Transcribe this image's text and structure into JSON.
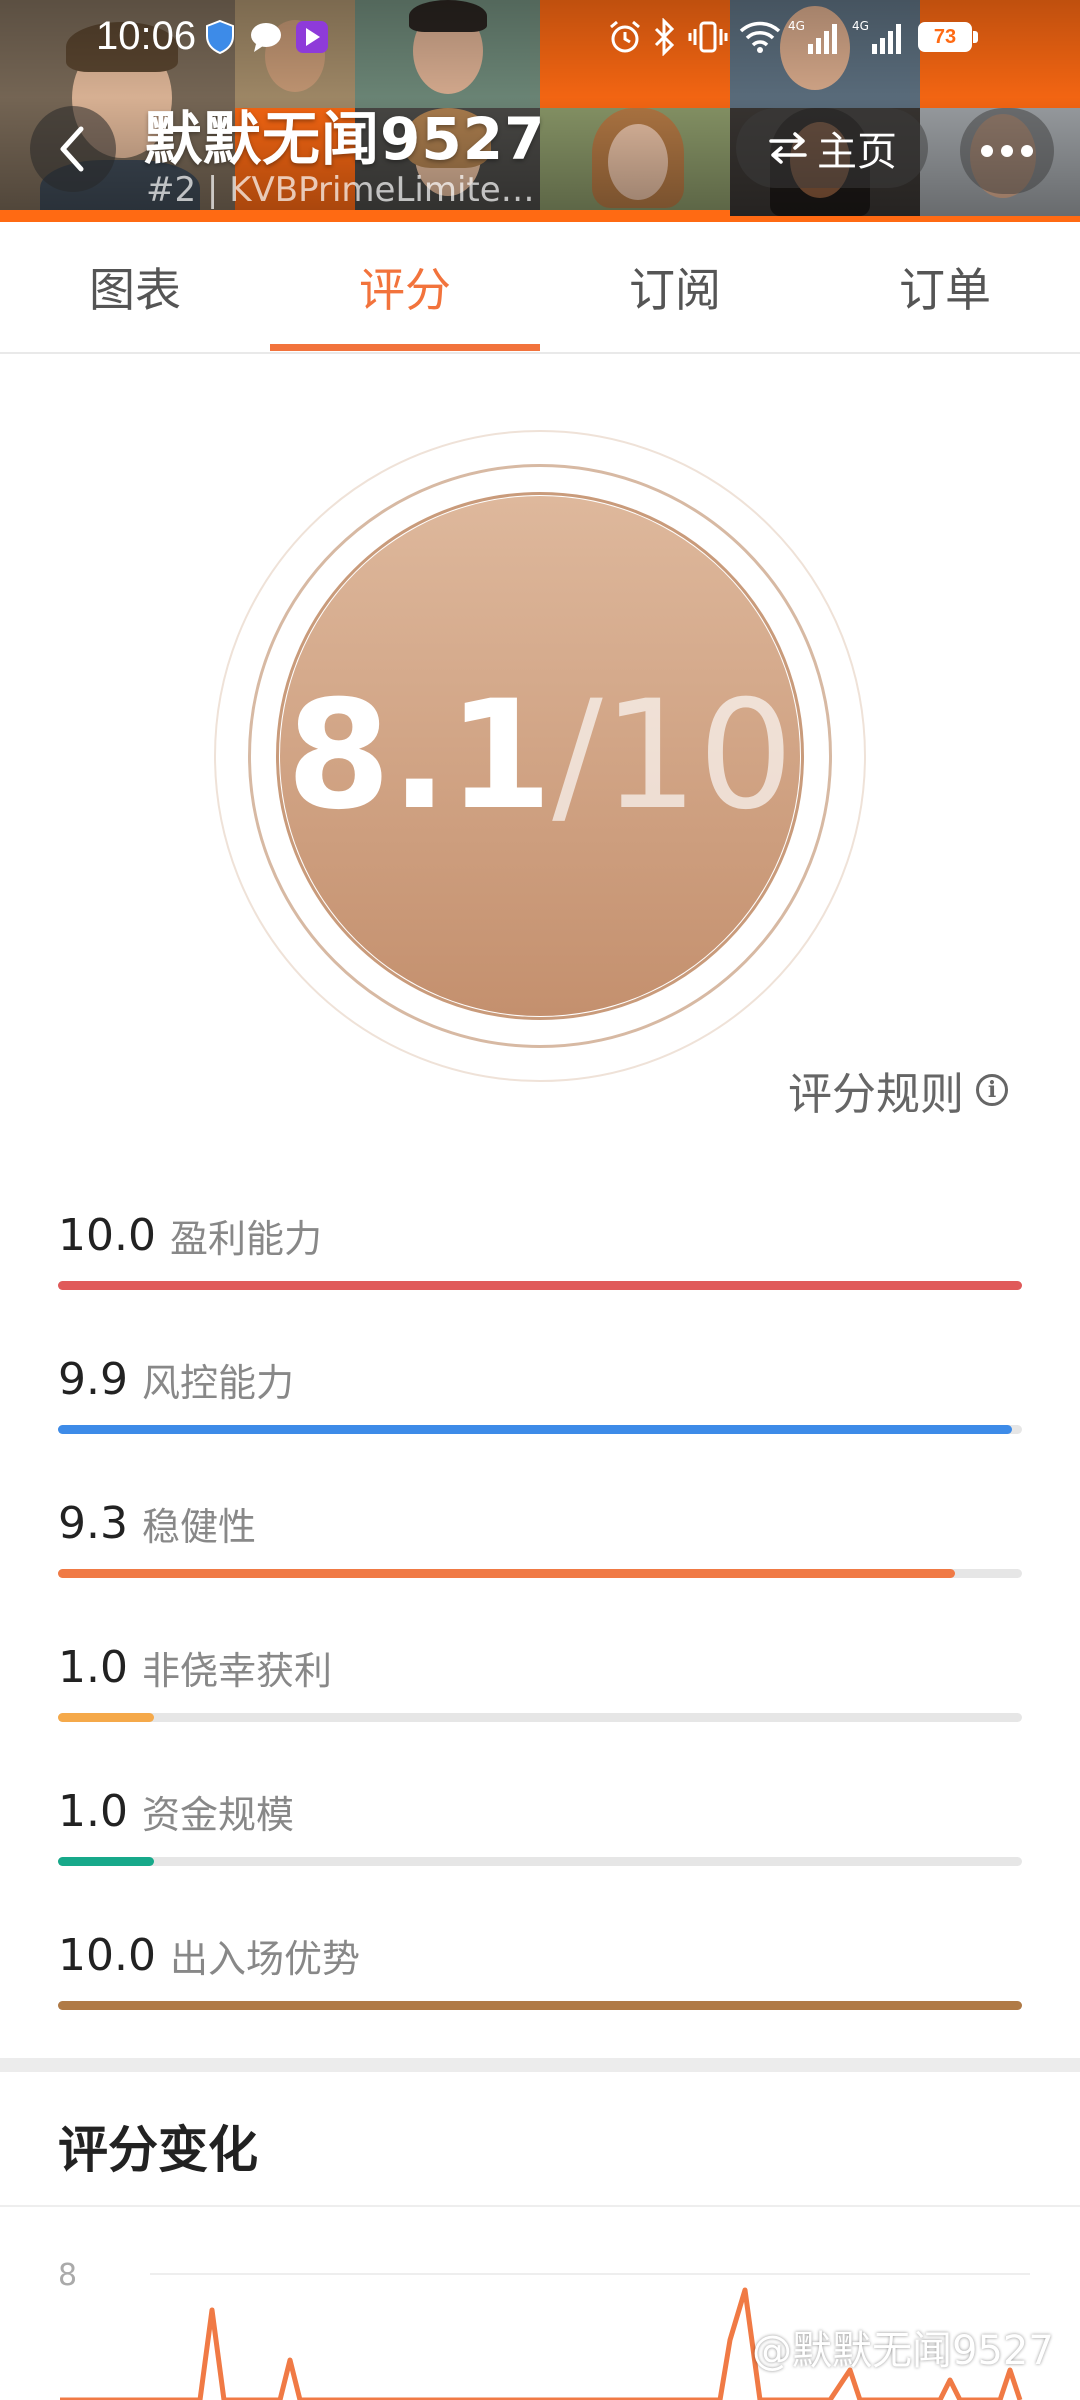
{
  "status_bar": {
    "time": "10:06",
    "battery": "73"
  },
  "header": {
    "title": "默默无闻9527",
    "subtitle": "#2 | KVBPrimeLimite…",
    "home_label": "主页"
  },
  "tabs": [
    {
      "label": "图表",
      "active": false
    },
    {
      "label": "评分",
      "active": true
    },
    {
      "label": "订阅",
      "active": false
    },
    {
      "label": "订单",
      "active": false
    }
  ],
  "score": {
    "value": "8.1",
    "suffix": "/10"
  },
  "rules_link": "评分规则",
  "metrics": [
    {
      "value": "10.0",
      "name": "盈利能力",
      "score": 10.0,
      "color": "#e05a5a"
    },
    {
      "value": "9.9",
      "name": "风控能力",
      "score": 9.9,
      "color": "#3d8be8"
    },
    {
      "value": "9.3",
      "name": "稳健性",
      "score": 9.3,
      "color": "#f07a45"
    },
    {
      "value": "1.0",
      "name": "非侥幸获利",
      "score": 1.0,
      "color": "#f5a94a"
    },
    {
      "value": "1.0",
      "name": "资金规模",
      "score": 1.0,
      "color": "#17a98a"
    },
    {
      "value": "10.0",
      "name": "出入场优势",
      "score": 10.0,
      "color": "#b07a46"
    }
  ],
  "score_change": {
    "title": "评分变化",
    "y_tick": "8"
  },
  "watermark": "@默默无闻9527",
  "colors": {
    "accent": "#f2733c",
    "circle_top": "#deb89c",
    "circle_bottom": "#c4906e"
  }
}
